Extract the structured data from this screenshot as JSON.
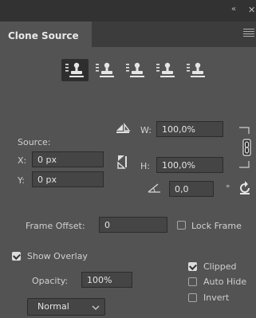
{
  "window": {
    "collapse_glyph": "«",
    "close_glyph": "✕"
  },
  "panel": {
    "tab_title": "Clone Source",
    "menu_icon": "hamburger-menu-icon"
  },
  "clone_sources": {
    "count": 5,
    "active_index": 0,
    "icon": "clone-stamp-icon"
  },
  "transform": {
    "source_label": "Source:",
    "x_label": "X:",
    "x_value": "0 px",
    "y_label": "Y:",
    "y_value": "0 px",
    "w_label": "W:",
    "w_value": "100,0%",
    "h_label": "H:",
    "h_value": "100,0%",
    "angle_value": "0,0",
    "degree_symbol": "°",
    "link_icon": "chain-link-icon",
    "reset_icon": "reset-transform-icon",
    "angle_icon": "angle-icon",
    "flip_h_icon": "flip-horizontal-icon",
    "flip_v_icon": "flip-vertical-icon"
  },
  "frame": {
    "offset_label": "Frame Offset:",
    "offset_value": "0",
    "lock_label": "Lock Frame",
    "lock_checked": false
  },
  "overlay": {
    "show_label": "Show Overlay",
    "show_checked": true,
    "opacity_label": "Opacity:",
    "opacity_value": "100%",
    "blend_mode": "Normal",
    "clipped_label": "Clipped",
    "clipped_checked": true,
    "autohide_label": "Auto Hide",
    "autohide_checked": false,
    "invert_label": "Invert",
    "invert_checked": false
  },
  "colors": {
    "panel_bg": "#535353",
    "dark_bar": "#323232",
    "field_bg": "#454545"
  }
}
